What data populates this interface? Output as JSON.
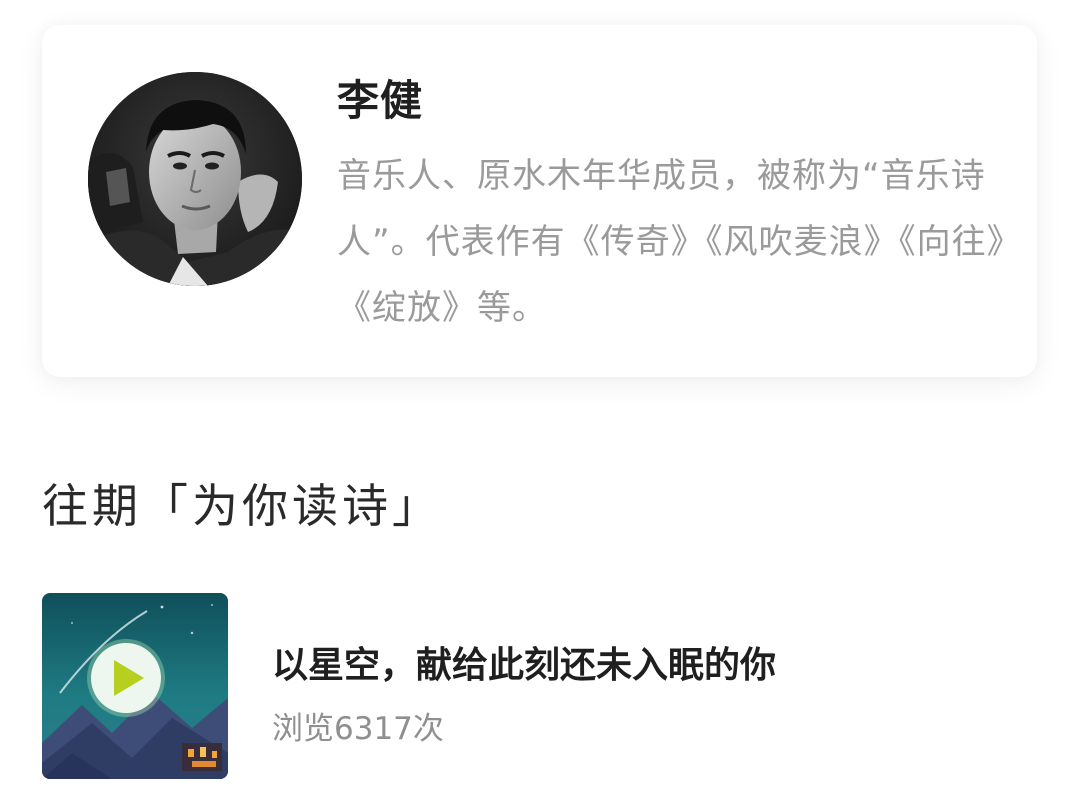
{
  "profile": {
    "name": "李健",
    "bio": "音乐人、原水木年华成员，被称为“音乐诗人”。代表作有《传奇》《风吹麦浪》《向往》《绽放》等。"
  },
  "section": {
    "title": "往期「为你读诗」"
  },
  "episodes": [
    {
      "title": "以星空，献给此刻还未入眠的你",
      "views": "浏览6317次",
      "thumbnail_icon": "starry-mountain-night-thumbnail",
      "play_icon": "play-icon"
    }
  ],
  "colors": {
    "name": "#1f1f1f",
    "bio": "#9a9a9a",
    "views": "#8f8f8f",
    "play_accent": "#b7cf1f"
  }
}
